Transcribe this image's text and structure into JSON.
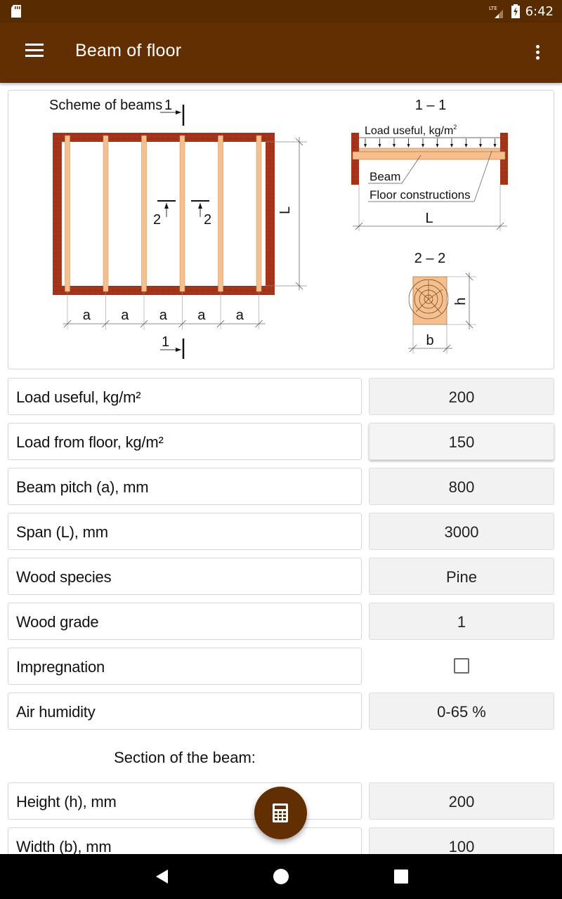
{
  "status_bar": {
    "time": "6:42",
    "network": "LTE",
    "icons": [
      "sd-card-icon",
      "lte-signal-icon",
      "battery-charging-icon"
    ]
  },
  "app_bar": {
    "title": "Beam of floor",
    "menu_icon": "hamburger-menu-icon",
    "overflow_icon": "more-vert-icon"
  },
  "scheme": {
    "title": "Scheme of beams",
    "section_1_label": "1",
    "section_2_label": "2",
    "span_label": "L",
    "pitch_label": "a",
    "pitch_count": 5,
    "section_1_1_title": "1 – 1",
    "section_2_2_title": "2 – 2",
    "load_label": "Load useful, kg/m",
    "load_sup": "2",
    "beam_label": "Beam",
    "floor_label": "Floor constructions",
    "height_label": "h",
    "width_label": "b"
  },
  "colors": {
    "primary": "#622f03",
    "status_bar": "#582b00",
    "wall": "#a5361b",
    "beam": "#f6c08e"
  },
  "fields": [
    {
      "label": "Load useful, kg/m²",
      "value": "200"
    },
    {
      "label": "Load from floor, kg/m²",
      "value": "150"
    },
    {
      "label": "Beam pitch (a), mm",
      "value": "800"
    },
    {
      "label": "Span (L), mm",
      "value": "3000"
    },
    {
      "label": "Wood species",
      "value": "Pine"
    },
    {
      "label": "Wood grade",
      "value": "1"
    },
    {
      "label": "Impregnation",
      "checked": false
    },
    {
      "label": "Air humidity",
      "value": "0-65 %"
    }
  ],
  "section_heading": "Section of the beam:",
  "section_fields": [
    {
      "label": "Height (h), mm",
      "value": "200"
    },
    {
      "label": "Width (b), mm",
      "value": "100"
    }
  ],
  "fab": {
    "icon": "calculator-icon"
  },
  "nav": {
    "back": "back-icon",
    "home": "home-icon",
    "recents": "recents-icon"
  }
}
